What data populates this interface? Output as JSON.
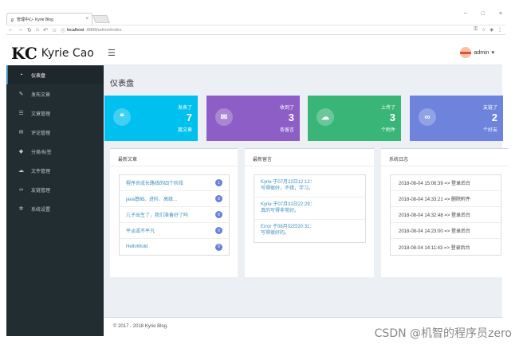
{
  "browser": {
    "tab_title": "管理中心- Kyrie Blog",
    "url_host": "localhost",
    "url_path": ":8888/admin/index",
    "window_controls": [
      "−",
      "□",
      "×"
    ]
  },
  "brand": {
    "mark": "KC",
    "name": "Kyrie Cao"
  },
  "header": {
    "user_name": "admin",
    "menu_icon": "hamburger-icon"
  },
  "sidebar": {
    "items": [
      {
        "label": "仪表盘",
        "icon": "dashboard-icon",
        "glyph": "◔",
        "active": true
      },
      {
        "label": "发布文章",
        "icon": "edit-icon",
        "glyph": "✎",
        "active": false
      },
      {
        "label": "文章管理",
        "icon": "list-icon",
        "glyph": "☰",
        "active": false
      },
      {
        "label": "评论管理",
        "icon": "comments-icon",
        "glyph": "✉",
        "active": false
      },
      {
        "label": "分类/标签",
        "icon": "tags-icon",
        "glyph": "◆",
        "active": false
      },
      {
        "label": "文件管理",
        "icon": "cloud-upload-icon",
        "glyph": "☁",
        "active": false
      },
      {
        "label": "友链管理",
        "icon": "link-icon",
        "glyph": "∞",
        "active": false
      },
      {
        "label": "系统设置",
        "icon": "gear-icon",
        "glyph": "✲",
        "active": false
      }
    ]
  },
  "page": {
    "title": "仪表盘"
  },
  "stats": [
    {
      "label": "发表了",
      "value": "7",
      "sub": "篇文章",
      "color": "#00c0ef",
      "icon": "quote-icon",
      "glyph": "❝"
    },
    {
      "label": "收到了",
      "value": "3",
      "sub": "条留言",
      "color": "#8e5ec7",
      "icon": "comment-icon",
      "glyph": "✉"
    },
    {
      "label": "上传了",
      "value": "3",
      "sub": "个附件",
      "color": "#3ab578",
      "icon": "cloud-upload-icon",
      "glyph": "☁"
    },
    {
      "label": "友链了",
      "value": "2",
      "sub": "个好友",
      "color": "#6d83dc",
      "icon": "link-icon",
      "glyph": "∞"
    }
  ],
  "panels": {
    "articles": {
      "title": "最新文章",
      "items": [
        {
          "title": "程序员成长路线的四个阶段",
          "count": "1"
        },
        {
          "title": "java基础、进阶、高级...",
          "count": "0"
        },
        {
          "title": "儿子出生了，我们准备好了吗",
          "count": "0"
        },
        {
          "title": "平淡或不平凡",
          "count": "0"
        },
        {
          "title": "HelloWold",
          "count": "0"
        }
      ]
    },
    "comments": {
      "title": "最新留言",
      "items": [
        {
          "who": "Kyrie 于07月22日12:12：",
          "text": "写得很好，不错，学习。"
        },
        {
          "who": "Kyrie 于07月31日22:29：",
          "text": "真的写得非常好。"
        },
        {
          "who": "Error 于08月02日20:31：",
          "text": "写得很好的。"
        }
      ]
    },
    "logs": {
      "title": "系统日志",
      "items": [
        "2018-08-04 15:06:39 => 登录后台",
        "2018-08-04 14:33:21 => 删除附件",
        "2018-08-04 14:32:48 => 登录后台",
        "2018-08-04 14:23:00 => 登录后台",
        "2018-08-04 14:11:43 => 登录后台"
      ]
    }
  },
  "footer": {
    "text": "© 2017 - 2018 Kyrie Blog."
  },
  "watermark": "CSDN @机智的程序员zero"
}
